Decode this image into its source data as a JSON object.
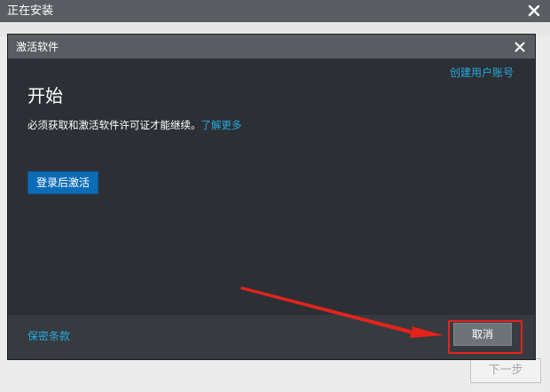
{
  "window": {
    "title": "正在安装",
    "next_button": "下一步"
  },
  "dialog": {
    "title": "激活软件",
    "create_account_link": "创建用户账号",
    "heading": "开始",
    "description": "必须获取和激活软件许可证才能继续。",
    "learn_more_link": "了解更多",
    "signin_button": "登录后激活",
    "privacy_link": "保密条款",
    "cancel_button": "取消"
  },
  "annotation": {
    "highlight_color": "#e5231b"
  }
}
